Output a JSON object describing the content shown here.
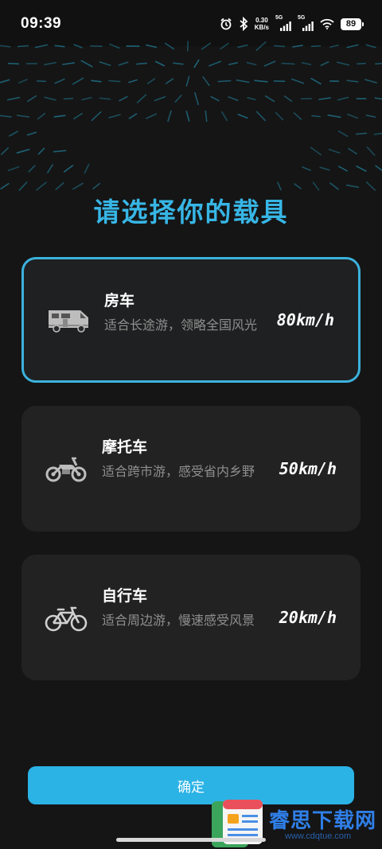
{
  "status_bar": {
    "time": "09:39",
    "net_speed_value": "0.30",
    "net_speed_unit": "KB/s",
    "signal1_label": "5G",
    "signal2_label": "5G",
    "battery": "89"
  },
  "page_title": "请选择你的载具",
  "vehicles": [
    {
      "title": "房车",
      "desc": "适合长途游，领略全国风光",
      "speed": "80km/h",
      "icon": "rv-icon",
      "selected": true
    },
    {
      "title": "摩托车",
      "desc": "适合跨市游，感受省内乡野",
      "speed": "50km/h",
      "icon": "motorcycle-icon",
      "selected": false
    },
    {
      "title": "自行车",
      "desc": "适合周边游，慢速感受风景",
      "speed": "20km/h",
      "icon": "bicycle-icon",
      "selected": false
    }
  ],
  "confirm_label": "确定",
  "watermark": {
    "text": "睿思下载网",
    "sub": "www.cdqtue.com"
  },
  "colors": {
    "accent": "#37b6e6",
    "button": "#2bb3e6",
    "background": "#151515",
    "card": "#222222"
  }
}
